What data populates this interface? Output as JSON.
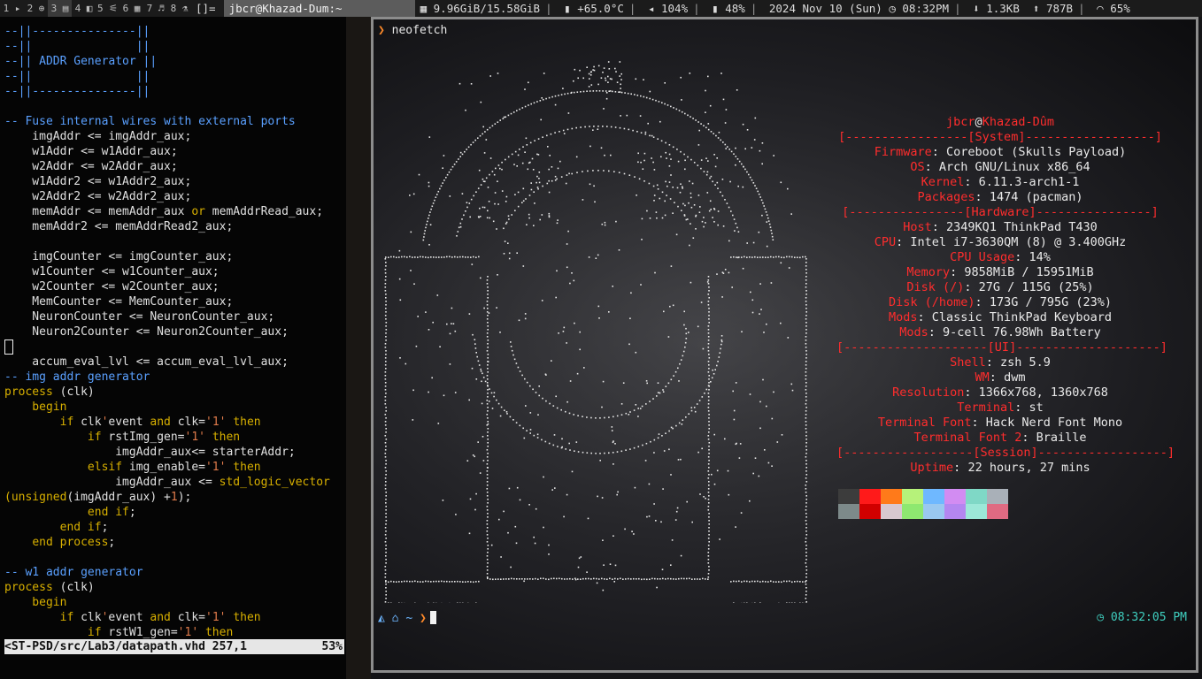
{
  "bar": {
    "tags": [
      "1 ▸",
      "2 ⊕",
      "3 ▤",
      "4 ◧",
      "5 ⚟",
      "6 ▦",
      "7 ♬",
      "8 ⚗"
    ],
    "selected_tag": 3,
    "layout": "[]=",
    "window_title": "jbcr@Khazad-Dum:~",
    "memory": "9.96GiB/15.58GiB",
    "temp": "+65.0°C",
    "volume": "104%",
    "battery": "48%",
    "date": "2024 Nov 10 (Sun)",
    "time": "08:32PM",
    "download": "1.3KB",
    "upload": "787B",
    "wifi": "65%"
  },
  "vim": {
    "lines": [
      [
        [
          "cm",
          "--||---------------||"
        ]
      ],
      [
        [
          "cm",
          "--||               ||"
        ]
      ],
      [
        [
          "cm",
          "--|| ADDR Generator ||"
        ]
      ],
      [
        [
          "cm",
          "--||               ||"
        ]
      ],
      [
        [
          "cm",
          "--||---------------||"
        ]
      ],
      [
        [
          "op",
          ""
        ]
      ],
      [
        [
          "cm",
          "-- Fuse internal wires with external ports"
        ]
      ],
      [
        [
          "op",
          "    imgAddr <= imgAddr_aux;"
        ]
      ],
      [
        [
          "op",
          "    w1Addr <= w1Addr_aux;"
        ]
      ],
      [
        [
          "op",
          "    w2Addr <= w2Addr_aux;"
        ]
      ],
      [
        [
          "op",
          "    w1Addr2 <= w1Addr2_aux;"
        ]
      ],
      [
        [
          "op",
          "    w2Addr2 <= w2Addr2_aux;"
        ]
      ],
      [
        [
          "op",
          "    memAddr <= memAddr_aux "
        ],
        [
          "kw",
          "or"
        ],
        [
          "op",
          " memAddrRead_aux;"
        ]
      ],
      [
        [
          "op",
          "    memAddr2 <= memAddrRead2_aux;"
        ]
      ],
      [
        [
          "op",
          ""
        ]
      ],
      [
        [
          "op",
          "    imgCounter <= imgCounter_aux;"
        ]
      ],
      [
        [
          "op",
          "    w1Counter <= w1Counter_aux;"
        ]
      ],
      [
        [
          "op",
          "    w2Counter <= w2Counter_aux;"
        ]
      ],
      [
        [
          "op",
          "    MemCounter <= MemCounter_aux;"
        ]
      ],
      [
        [
          "op",
          "    NeuronCounter <= NeuronCounter_aux;"
        ]
      ],
      [
        [
          "op",
          "    Neuron2Counter <= Neuron2Counter_aux;"
        ]
      ],
      [
        [
          "cursor",
          ""
        ]
      ],
      [
        [
          "op",
          "    accum_eval_lvl <= accum_eval_lvl_aux;"
        ]
      ],
      [
        [
          "cm",
          "-- img addr generator"
        ]
      ],
      [
        [
          "kw",
          "process"
        ],
        [
          "op",
          " (clk)"
        ]
      ],
      [
        [
          "kw",
          "    begin"
        ]
      ],
      [
        [
          "op",
          "        "
        ],
        [
          "kw",
          "if"
        ],
        [
          "op",
          " clk"
        ],
        [
          "st",
          "'"
        ],
        [
          "op",
          "event "
        ],
        [
          "kw",
          "and"
        ],
        [
          "op",
          " clk="
        ],
        [
          "st",
          "'1'"
        ],
        [
          "op",
          " "
        ],
        [
          "kw",
          "then"
        ]
      ],
      [
        [
          "op",
          "            "
        ],
        [
          "kw",
          "if"
        ],
        [
          "op",
          " rstImg_gen="
        ],
        [
          "st",
          "'1'"
        ],
        [
          "op",
          " "
        ],
        [
          "kw",
          "then"
        ]
      ],
      [
        [
          "op",
          "                imgAddr_aux<= starterAddr;"
        ]
      ],
      [
        [
          "op",
          "            "
        ],
        [
          "kw",
          "elsif"
        ],
        [
          "op",
          " img_enable="
        ],
        [
          "st",
          "'1'"
        ],
        [
          "op",
          " "
        ],
        [
          "kw",
          "then"
        ]
      ],
      [
        [
          "op",
          "                imgAddr_aux <= "
        ],
        [
          "kw",
          "std_logic_vector"
        ]
      ],
      [
        [
          "kw",
          "(unsigned"
        ],
        [
          "op",
          "(imgAddr_aux) +"
        ],
        [
          "st",
          "1"
        ],
        [
          "op",
          ");"
        ]
      ],
      [
        [
          "op",
          "            "
        ],
        [
          "kw",
          "end if"
        ],
        [
          "op",
          ";"
        ]
      ],
      [
        [
          "op",
          "        "
        ],
        [
          "kw",
          "end if"
        ],
        [
          "op",
          ";"
        ]
      ],
      [
        [
          "op",
          "    "
        ],
        [
          "kw",
          "end process"
        ],
        [
          "op",
          ";"
        ]
      ],
      [
        [
          "op",
          ""
        ]
      ],
      [
        [
          "cm",
          "-- w1 addr generator"
        ]
      ],
      [
        [
          "kw",
          "process"
        ],
        [
          "op",
          " (clk)"
        ]
      ],
      [
        [
          "kw",
          "    begin"
        ]
      ],
      [
        [
          "op",
          "        "
        ],
        [
          "kw",
          "if"
        ],
        [
          "op",
          " clk"
        ],
        [
          "st",
          "'"
        ],
        [
          "op",
          "event "
        ],
        [
          "kw",
          "and"
        ],
        [
          "op",
          " clk="
        ],
        [
          "st",
          "'1'"
        ],
        [
          "op",
          " "
        ],
        [
          "kw",
          "then"
        ]
      ],
      [
        [
          "op",
          "            "
        ],
        [
          "kw",
          "if"
        ],
        [
          "op",
          " rstW1_gen="
        ],
        [
          "st",
          "'1'"
        ],
        [
          "op",
          " "
        ],
        [
          "kw",
          "then"
        ]
      ]
    ],
    "status_file": "<ST-PSD/src/Lab3/datapath.vhd 257,1",
    "status_pct": "53%"
  },
  "terminal": {
    "command": "neofetch",
    "info": [
      {
        "type": "title",
        "user": "jbcr",
        "host": "Khazad-Dûm"
      },
      {
        "type": "header",
        "text": "[-----------------[System]------------------]"
      },
      {
        "type": "kv",
        "k": "Firmware",
        "v": "Coreboot (Skulls Payload)"
      },
      {
        "type": "kv",
        "k": "OS",
        "v": "Arch GNU/Linux x86_64"
      },
      {
        "type": "kv",
        "k": "Kernel",
        "v": "6.11.3-arch1-1"
      },
      {
        "type": "kv",
        "k": "Packages",
        "v": "1474 (pacman)"
      },
      {
        "type": "header",
        "text": "[----------------[Hardware]----------------]"
      },
      {
        "type": "kv",
        "k": "Host",
        "v": "2349KQ1 ThinkPad T430"
      },
      {
        "type": "kv",
        "k": "CPU",
        "v": "Intel i7-3630QM (8) @ 3.400GHz"
      },
      {
        "type": "kv",
        "k": "CPU Usage",
        "v": "14%"
      },
      {
        "type": "kv",
        "k": "Memory",
        "v": "9858MiB / 15951MiB"
      },
      {
        "type": "kv",
        "k": "Disk (/)",
        "v": "27G / 115G (25%)"
      },
      {
        "type": "kv",
        "k": "Disk (/home)",
        "v": "173G / 795G (23%)"
      },
      {
        "type": "kv",
        "k": "Mods",
        "v": "Classic ThinkPad Keyboard"
      },
      {
        "type": "kv",
        "k": "Mods",
        "v": "9-cell 76.98Wh Battery"
      },
      {
        "type": "header",
        "text": "[--------------------[UI]--------------------]"
      },
      {
        "type": "kv",
        "k": "Shell",
        "v": "zsh 5.9"
      },
      {
        "type": "kv",
        "k": "WM",
        "v": "dwm"
      },
      {
        "type": "kv",
        "k": "Resolution",
        "v": "1366x768, 1360x768"
      },
      {
        "type": "kv",
        "k": "Terminal",
        "v": "st"
      },
      {
        "type": "kv",
        "k": "Terminal Font",
        "v": "Hack Nerd Font Mono"
      },
      {
        "type": "kv",
        "k": "Terminal Font 2",
        "v": "Braille"
      },
      {
        "type": "header",
        "text": "[------------------[Session]------------------]"
      },
      {
        "type": "kv",
        "k": "Uptime",
        "v": "22 hours, 27 mins"
      }
    ],
    "palette_top": [
      "#3c3c3c",
      "#ff1a1a",
      "#ff7a1a",
      "#b6f27a",
      "#6fb8ff",
      "#d28cf2",
      "#7fd8c6",
      "#a9b0b8"
    ],
    "palette_bottom": [
      "#7d8a8a",
      "#d10000",
      "#d8c8d0",
      "#8ee870",
      "#9ac8f0",
      "#b486f0",
      "#9ce8d8",
      "#e06a82"
    ],
    "prompt_path": "~",
    "clock": "08:32:05 PM"
  }
}
